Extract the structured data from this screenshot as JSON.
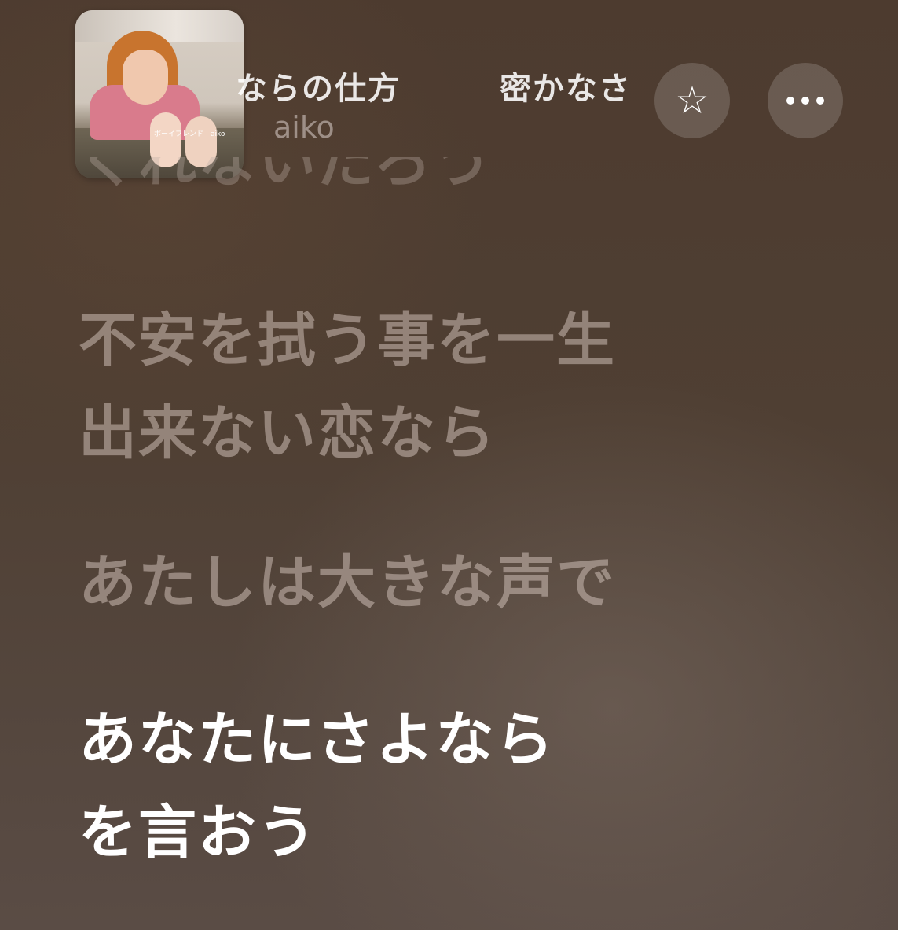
{
  "header": {
    "song_title": "ならの仕方　　　密かなさ",
    "artist": "aiko",
    "album_art": {
      "caption": "ボーイフレンド　aiko"
    },
    "favorite_icon": "star-outline-icon",
    "more_icon": "ellipsis-icon"
  },
  "lyrics": {
    "partial_line": "くれないだろう",
    "lines": [
      {
        "text": "不安を拭う事を一生",
        "state": "past"
      },
      {
        "text": "出来ない恋なら",
        "state": "past"
      },
      {
        "text": "あたしは大きな声で",
        "state": "past"
      },
      {
        "text": "あなたにさよなら",
        "state": "current"
      },
      {
        "text": "を言おう",
        "state": "current"
      }
    ]
  },
  "colors": {
    "background_top": "#4d3b2f",
    "background_bottom": "#5a4c45",
    "lyric_active": "#ffffff",
    "lyric_dim": "#c9bbb2"
  }
}
